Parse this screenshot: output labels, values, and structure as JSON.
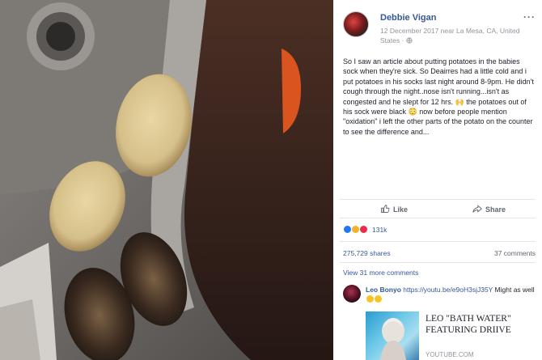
{
  "post": {
    "author": "Debbie Vigan",
    "meta": "12 December 2017 near La Mesa, CA, United States · ",
    "more_label": "···",
    "text": "So I saw an article about putting potatoes in the babies sock when they're sick. So Deairres had a little cold and i put potatoes in his socks last night around 8-9pm. He didn't cough through the night..nose isn't running...isn't as congested and he slept for 12 hrs. 🙌 the potatoes out of his sock were black 😳 now before people mention \"oxidation\" i left the other parts of the potato on the counter to see the difference and..."
  },
  "actions": {
    "like_label": "Like",
    "share_label": "Share"
  },
  "reactions": {
    "count": "131k",
    "types": [
      "like",
      "wow",
      "love"
    ]
  },
  "stats": {
    "shares": "275,729 shares",
    "comments": "37 comments"
  },
  "comments": {
    "view_more": "View 31 more comments",
    "items": [
      {
        "name": "Leo Bonyo",
        "link": "https://youtu.be/e9oH3sjJ35Y",
        "text": " Might as well "
      }
    ]
  },
  "link_preview": {
    "title": "LEO \"BATH WATER\" FEATURING DRIIVE",
    "domain": "YOUTUBE.COM"
  },
  "colors": {
    "link": "#365899",
    "meta": "#90949c",
    "text": "#1d2129"
  }
}
